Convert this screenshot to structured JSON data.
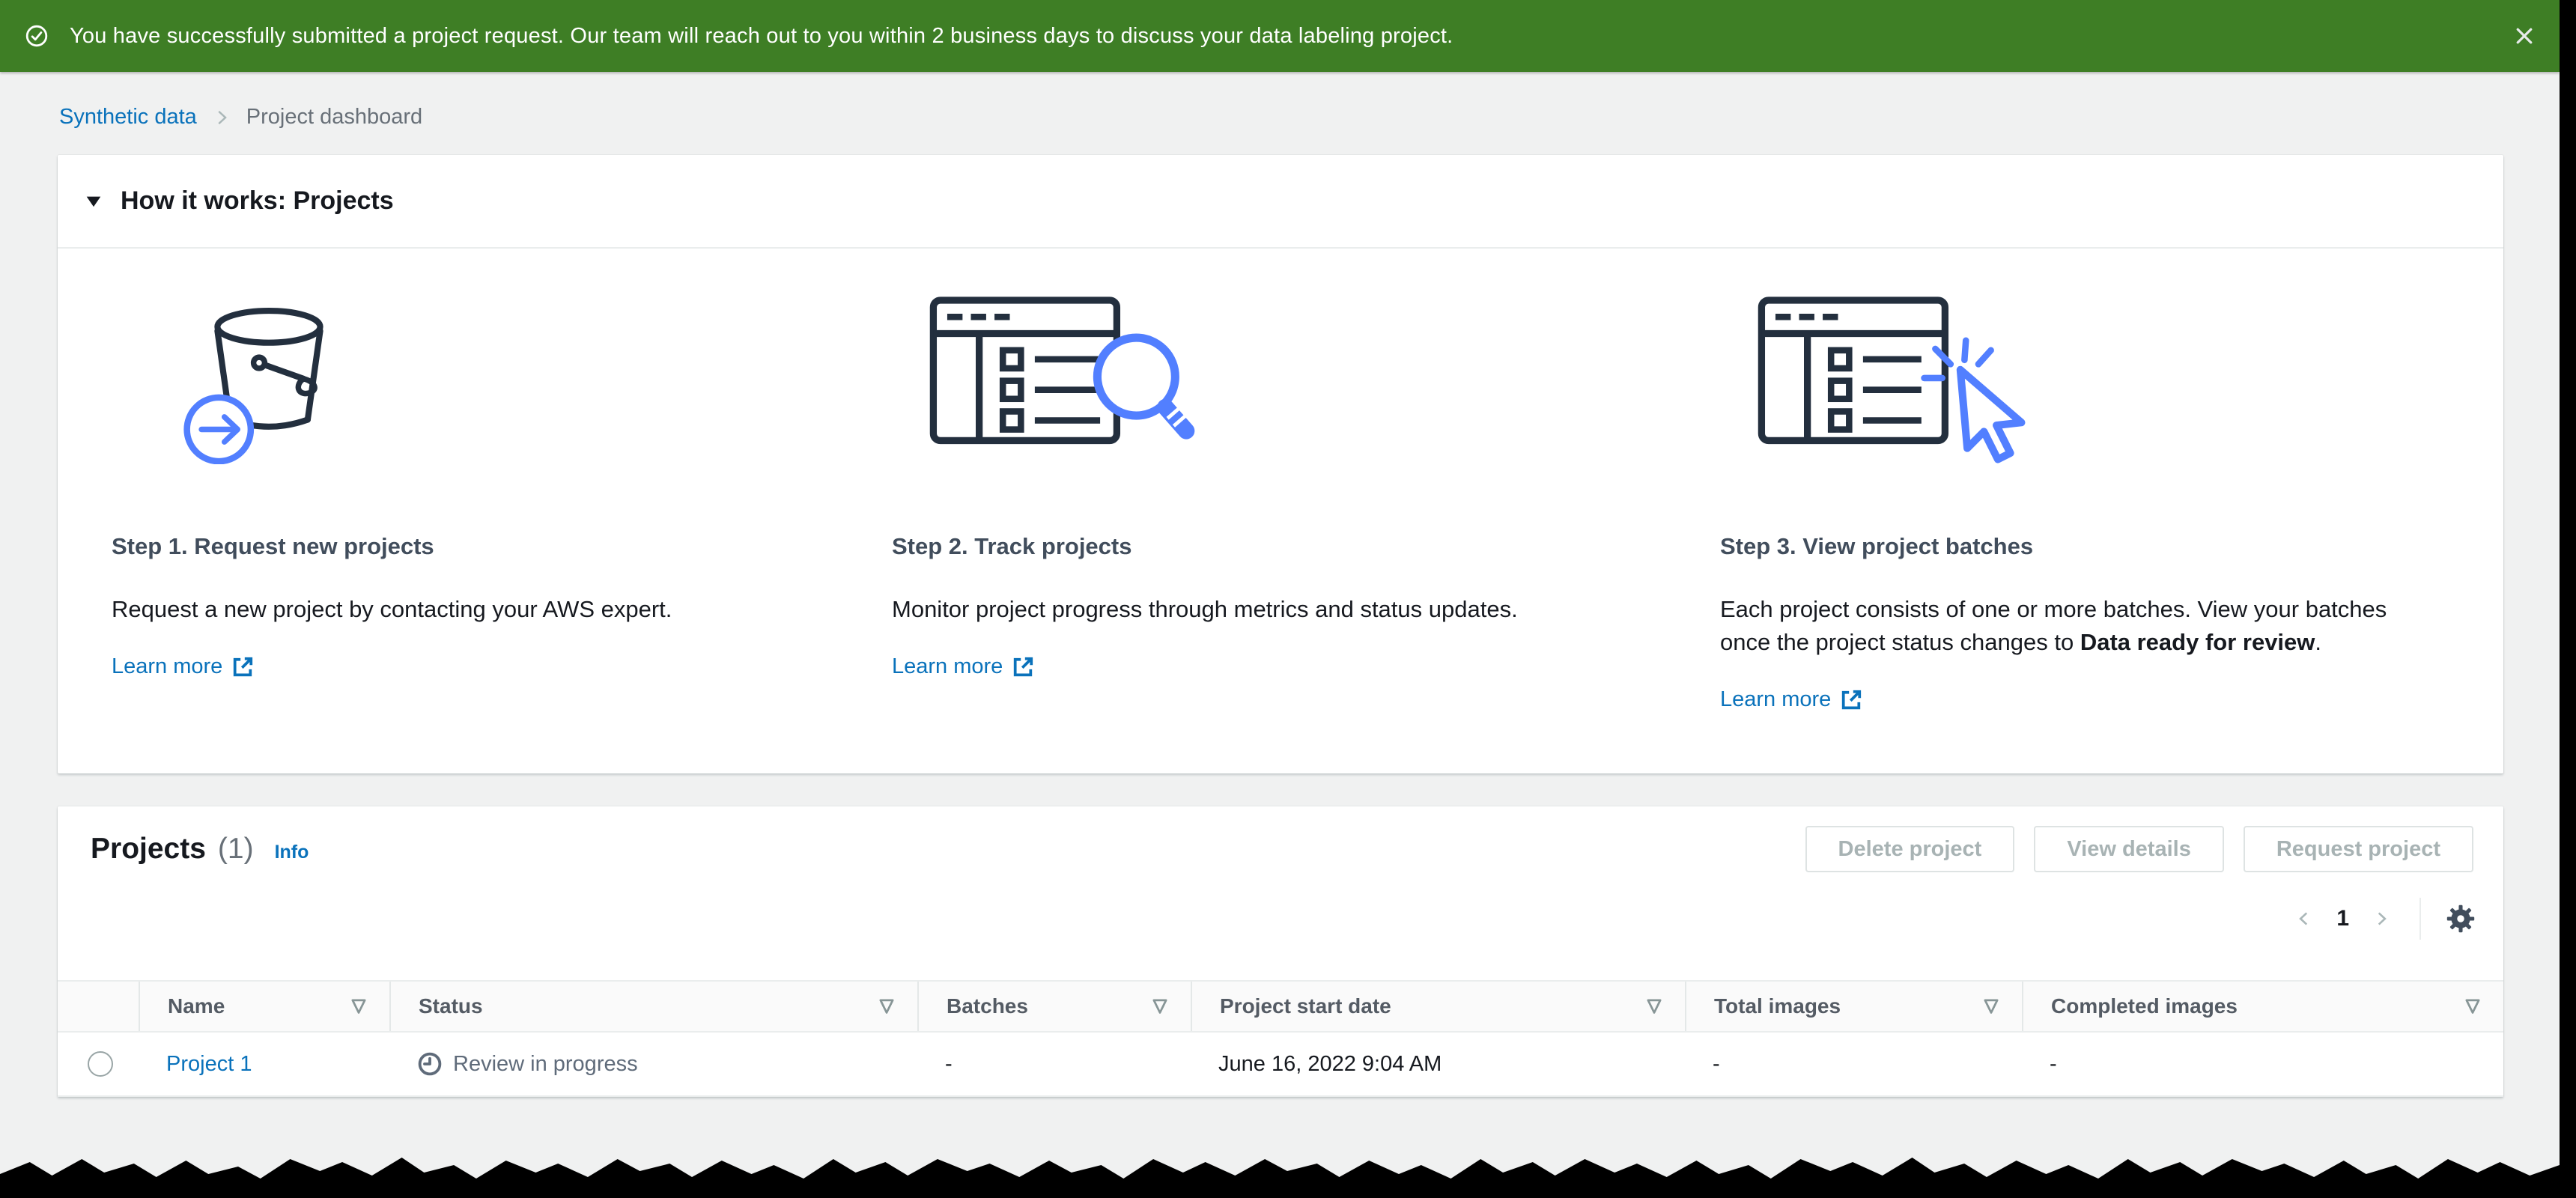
{
  "colors": {
    "banner_success": "#3e7e25",
    "link_blue": "#0a72bb",
    "icon_accent_blue": "#527fff",
    "icon_dark_outline": "#232f3e",
    "page_background": "#f0f1f1"
  },
  "banner": {
    "icon": "success-check-circle-icon",
    "message": "You have successfully submitted a project request. Our team will reach out to you within 2 business days to discuss your data labeling project."
  },
  "breadcrumb": {
    "link": "Synthetic data",
    "current": "Project dashboard"
  },
  "how_it_works": {
    "title": "How it works: Projects",
    "steps": [
      {
        "icon": "bucket-arrow-icon",
        "title": "Step 1. Request new projects",
        "desc_prefix": "Request a new project by contacting your AWS expert.",
        "desc_bold": "",
        "desc_suffix": "",
        "link": "Learn more"
      },
      {
        "icon": "window-list-magnifier-icon",
        "title": "Step 2. Track projects",
        "desc_prefix": "Monitor project progress through metrics and status updates.",
        "desc_bold": "",
        "desc_suffix": "",
        "link": "Learn more"
      },
      {
        "icon": "window-list-cursor-icon",
        "title": "Step 3. View project batches",
        "desc_prefix": "Each project consists of one or more batches. View your batches once the project status changes to ",
        "desc_bold": "Data ready for review",
        "desc_suffix": ".",
        "link": "Learn more"
      }
    ]
  },
  "projects": {
    "title": "Projects",
    "count": "(1)",
    "info": "Info",
    "actions": [
      {
        "label": "Delete project"
      },
      {
        "label": "View details"
      },
      {
        "label": "Request project"
      }
    ],
    "pagination": {
      "page": "1"
    },
    "table": {
      "columns": [
        {
          "label": "Name"
        },
        {
          "label": "Status"
        },
        {
          "label": "Batches"
        },
        {
          "label": "Project start date"
        },
        {
          "label": "Total images"
        },
        {
          "label": "Completed images"
        }
      ],
      "row": {
        "name": "Project 1",
        "status": "Review in progress",
        "batches": "-",
        "start_date": "June 16, 2022 9:04 AM",
        "total_images": "-",
        "completed_images": "-"
      }
    }
  }
}
